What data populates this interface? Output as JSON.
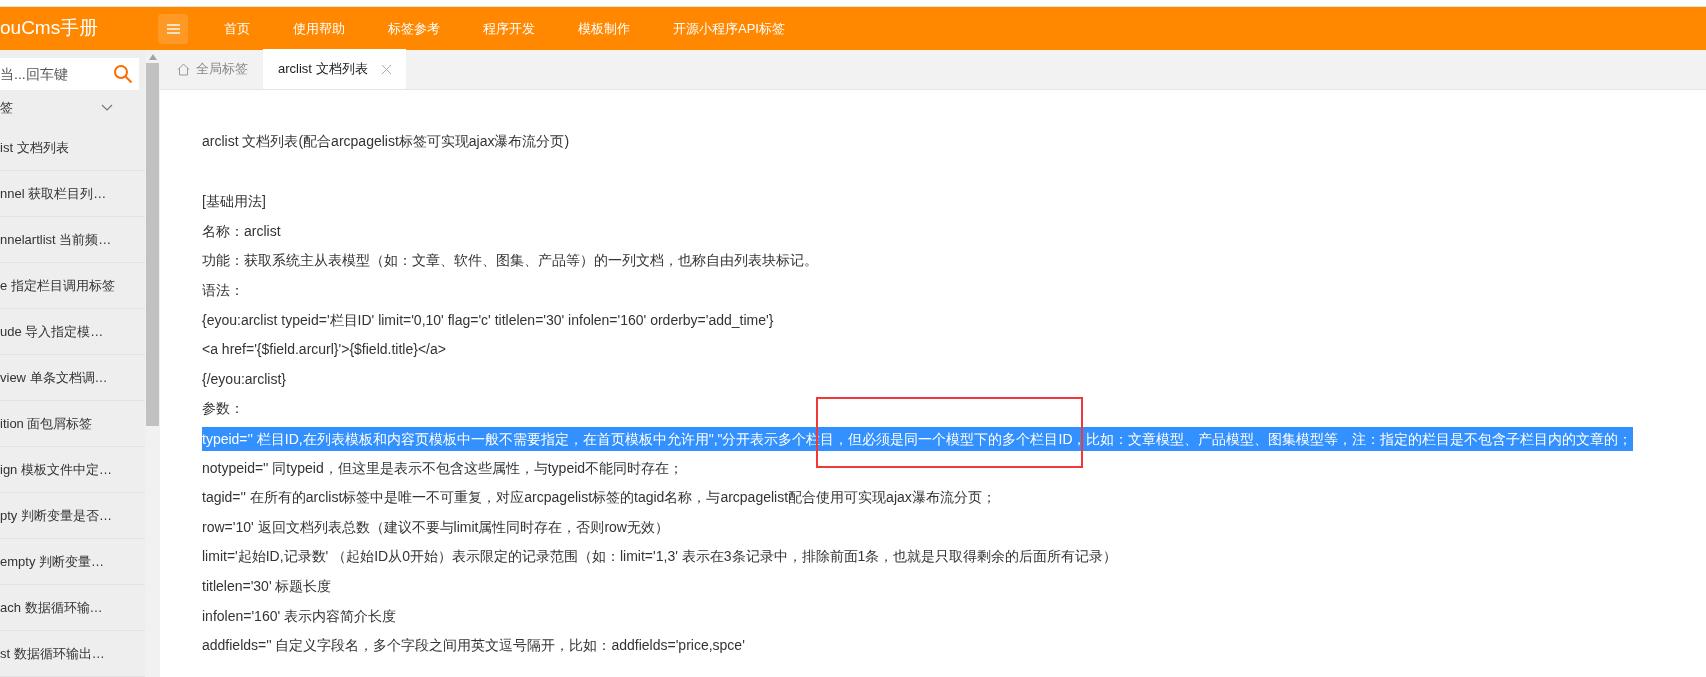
{
  "header": {
    "logo": "ouCms手册",
    "nav": [
      {
        "label": "首页"
      },
      {
        "label": "使用帮助"
      },
      {
        "label": "标签参考"
      },
      {
        "label": "程序开发"
      },
      {
        "label": "模板制作"
      },
      {
        "label": "开源小程序API标签"
      }
    ]
  },
  "sidebar": {
    "search": {
      "placeholder": "当...回车键"
    },
    "group": {
      "label": "签",
      "expanded": true
    },
    "items": [
      {
        "label": "ist 文档列表"
      },
      {
        "label": "nnel 获取栏目列…"
      },
      {
        "label": "nnelartlist 当前频…"
      },
      {
        "label": "e 指定栏目调用标签"
      },
      {
        "label": "ude 导入指定模…"
      },
      {
        "label": "view 单条文档调…"
      },
      {
        "label": "ition 面包屑标签"
      },
      {
        "label": "ign 模板文件中定…"
      },
      {
        "label": "pty 判断变量是否…"
      },
      {
        "label": "empty 判断变量…"
      },
      {
        "label": "ach 数据循环输…"
      },
      {
        "label": "st 数据循环输出…"
      }
    ]
  },
  "tabs": [
    {
      "label": "全局标签",
      "kind": "home",
      "selected": false,
      "closable": false
    },
    {
      "label": "arclist 文档列表",
      "kind": "page",
      "selected": true,
      "closable": true
    }
  ],
  "content": {
    "annotation_box": true,
    "title": "arclist 文档列表(配合arcpagelist标签可实现ajax瀑布流分页)",
    "lines": [
      {
        "text": "[基础用法]",
        "highlighted": false
      },
      {
        "text": "名称：arclist",
        "highlighted": false
      },
      {
        "text": "功能：获取系统主从表模型（如：文章、软件、图集、产品等）的一列文档，也称自由列表块标记。",
        "highlighted": false
      },
      {
        "text": "语法：",
        "highlighted": false
      },
      {
        "text": "{eyou:arclist typeid='栏目ID' limit='0,10' flag='c' titlelen='30' infolen='160' orderby='add_time'}",
        "highlighted": false
      },
      {
        "text": "<a href='{$field.arcurl}'>{$field.title}</a>",
        "highlighted": false
      },
      {
        "text": "{/eyou:arclist}",
        "highlighted": false
      },
      {
        "text": "参数：",
        "highlighted": false
      },
      {
        "text": "typeid='' 栏目ID,在列表模板和内容页模板中一般不需要指定，在首页模板中允许用\",\"分开表示多个栏目，但必须是同一个模型下的多个栏目ID，比如：文章模型、产品模型、图集模型等，注：指定的栏目是不包含子栏目内的文章的；",
        "highlighted": true
      },
      {
        "text": "notypeid='' 同typeid，但这里是表示不包含这些属性，与typeid不能同时存在；",
        "highlighted": false
      },
      {
        "text": "tagid='' 在所有的arclist标签中是唯一不可重复，对应arcpagelist标签的tagid名称，与arcpagelist配合使用可实现ajax瀑布流分页；",
        "highlighted": false
      },
      {
        "text": "row='10' 返回文档列表总数（建议不要与limit属性同时存在，否则row无效）",
        "highlighted": false
      },
      {
        "text": "limit='起始ID,记录数' （起始ID从0开始）表示限定的记录范围（如：limit='1,3' 表示在3条记录中，排除前面1条，也就是只取得剩余的后面所有记录）",
        "highlighted": false
      },
      {
        "text": "titlelen='30' 标题长度",
        "highlighted": false
      },
      {
        "text": "infolen='160' 表示内容简介长度",
        "highlighted": false
      },
      {
        "text": "addfields='' 自定义字段名，多个字段之间用英文逗号隔开，比如：addfields='price,spce'",
        "highlighted": false
      }
    ]
  }
}
